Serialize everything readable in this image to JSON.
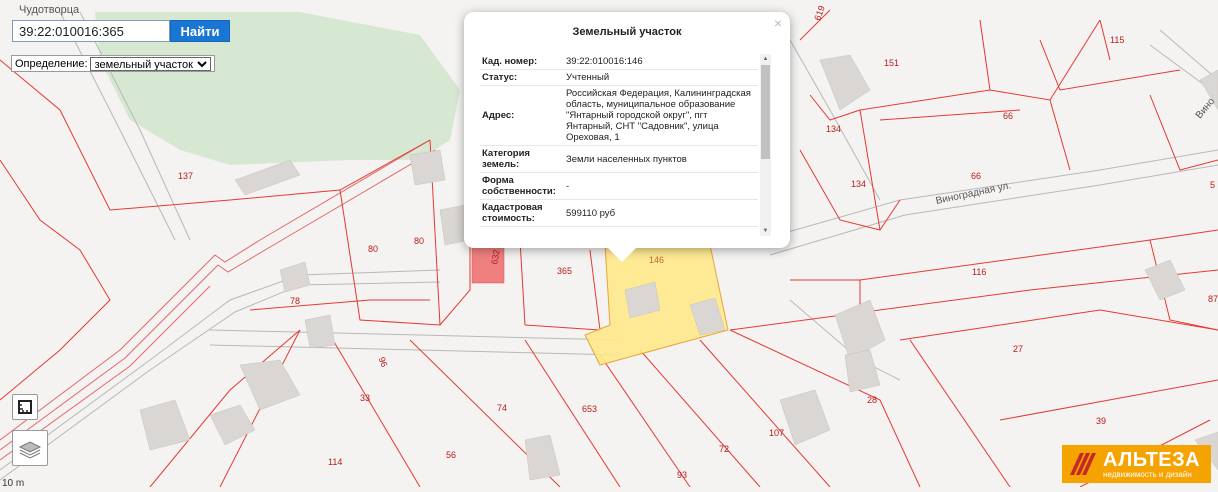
{
  "map": {
    "town_label": "Чудотворца",
    "scale_label": "10 m",
    "parcel_labels": [
      {
        "id": "137",
        "text": "137"
      },
      {
        "id": "80a",
        "text": "80"
      },
      {
        "id": "80b",
        "text": "80"
      },
      {
        "id": "632",
        "text": "632"
      },
      {
        "id": "365",
        "text": "365"
      },
      {
        "id": "146",
        "text": "146"
      },
      {
        "id": "78",
        "text": "78"
      },
      {
        "id": "96",
        "text": "96"
      },
      {
        "id": "33",
        "text": "33"
      },
      {
        "id": "74",
        "text": "74"
      },
      {
        "id": "653",
        "text": "653"
      },
      {
        "id": "114",
        "text": "114"
      },
      {
        "id": "56",
        "text": "56"
      },
      {
        "id": "93",
        "text": "93"
      },
      {
        "id": "72",
        "text": "72"
      },
      {
        "id": "107",
        "text": "107"
      },
      {
        "id": "28",
        "text": "28"
      },
      {
        "id": "27",
        "text": "27"
      },
      {
        "id": "39",
        "text": "39"
      },
      {
        "id": "116",
        "text": "116"
      },
      {
        "id": "134a",
        "text": "134"
      },
      {
        "id": "134b",
        "text": "134"
      },
      {
        "id": "151",
        "text": "151"
      },
      {
        "id": "66a",
        "text": "66"
      },
      {
        "id": "66b",
        "text": "66"
      },
      {
        "id": "115",
        "text": "115"
      },
      {
        "id": "5",
        "text": "5"
      },
      {
        "id": "87",
        "text": "87"
      },
      {
        "id": "619",
        "text": "619"
      }
    ],
    "street_labels": [
      "Виноградная ул.",
      "Вино"
    ]
  },
  "search": {
    "value": "39:22:010016:365",
    "button_label": "Найти"
  },
  "definition": {
    "label": "Определение:",
    "selected": "земельный участок"
  },
  "popup": {
    "title": "Земельный участок",
    "close": "×",
    "rows": [
      {
        "key": "Кад. номер:",
        "value": "39:22:010016:146"
      },
      {
        "key": "Статус:",
        "value": "Учтенный"
      },
      {
        "key": "Адрес:",
        "value": "Российская Федерация, Калининградская область, муниципальное образование \"Янтарный городской округ\", пгт Янтарный, СНТ \"Садовник\", улица Ореховая, 1"
      },
      {
        "key": "Категория земель:",
        "value": "Земли населенных пунктов"
      },
      {
        "key": "Форма собственности:",
        "value": "-"
      },
      {
        "key": "Кадастровая стоимость:",
        "value": "599110 руб"
      }
    ]
  },
  "logo": {
    "main": "АЛЬТЕЗА",
    "sub": "недвижимость и дизайн"
  },
  "colors": {
    "parcel_border": "#e53935",
    "selected_fill": "#ffe98a",
    "button": "#1976d2",
    "logo_bg": "#f5a300"
  }
}
